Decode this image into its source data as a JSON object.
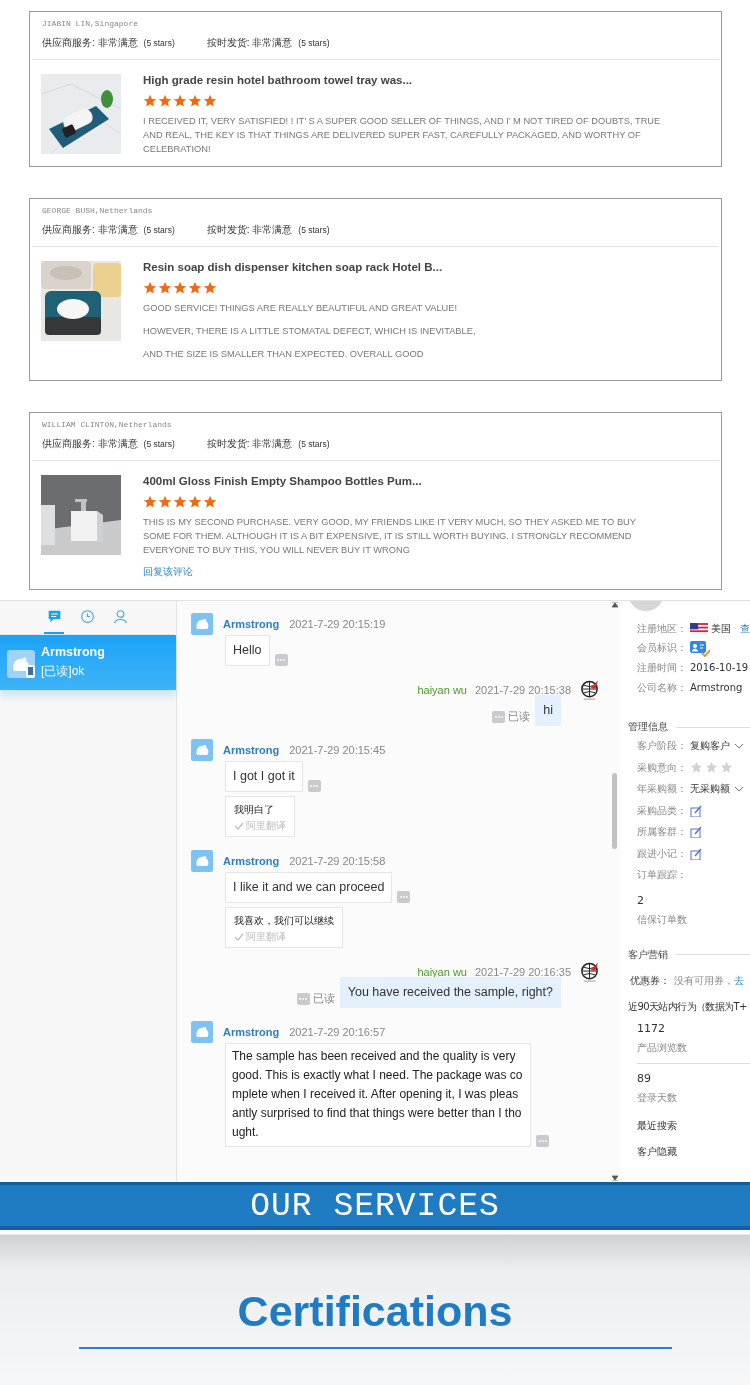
{
  "reviews": [
    {
      "reviewer": "JIABIN LIN,Singapore",
      "ratings": [
        {
          "label": "供应商服务:",
          "value": "非常满意",
          "note": "(5 stars)"
        },
        {
          "label": "按时发货:",
          "value": "非常满意",
          "note": "(5 stars)"
        }
      ],
      "product_title": "High grade resin hotel bathroom towel tray was...",
      "stars": 5,
      "paragraphs": [
        "I RECEIVED IT, VERY SATISFIED! ! IT’ S A SUPER GOOD SELLER OF THINGS, AND I’ M NOT TIRED OF DOUBTS, TRUE AND REAL, THE KEY IS THAT THINGS ARE DELIVERED SUPER FAST, CAREFULLY PACKAGED, AND WORTHY OF CELEBRATION!"
      ]
    },
    {
      "reviewer": "GEORGE BUSH,Netherlands",
      "ratings": [
        {
          "label": "供应商服务:",
          "value": "非常满意",
          "note": "(5 stars)"
        },
        {
          "label": "按时发货:",
          "value": "非常满意",
          "note": "(5 stars)"
        }
      ],
      "product_title": "Resin soap dish dispenser kitchen soap rack Hotel B...",
      "stars": 5,
      "paragraphs": [
        "GOOD SERVICE! THINGS ARE REALLY BEAUTIFUL AND GREAT VALUE!",
        "HOWEVER, THERE IS A LITTLE STOMATAL DEFECT, WHICH IS INEVITABLE,",
        "AND THE SIZE IS SMALLER THAN EXPECTED. OVERALL GOOD"
      ]
    },
    {
      "reviewer": "WILLIAM CLINTON,Netherlands",
      "ratings": [
        {
          "label": "供应商服务:",
          "value": "非常满意",
          "note": "(5 stars)"
        },
        {
          "label": "按时发货:",
          "value": "非常满意",
          "note": "(5 stars)"
        }
      ],
      "product_title": "400ml Gloss Finish Empty Shampoo Bottles Pum...",
      "stars": 5,
      "paragraphs": [
        "THIS IS MY SECOND PURCHASE. VERY GOOD, MY FRIENDS LIKE IT VERY MUCH, SO THEY ASKED ME TO BUY SOME FOR THEM. ALTHOUGH IT IS A BIT EXPENSIVE, IT IS STILL WORTH BUYING. I STRONGLY RECOMMEND EVERYONE TO BUY THIS, YOU WILL NEVER BUY IT WRONG"
      ],
      "reply_link": "回复该评论"
    }
  ],
  "chat": {
    "tabs": [
      {
        "kind": "messages",
        "selected": true
      },
      {
        "kind": "recent",
        "selected": false
      },
      {
        "kind": "contacts",
        "selected": false
      }
    ],
    "contacts": [
      {
        "name": "Armstrong",
        "preview": "[已读]ok",
        "selected": true
      }
    ],
    "messages": [
      {
        "kind": "incoming",
        "sender": "Armstrong",
        "time": "2021-7-29 20:15:19",
        "text": "Hello"
      },
      {
        "kind": "outgoing",
        "sender": "haiyan wu",
        "time": "2021-7-29 20:15:38",
        "text": "hi",
        "status": "已读"
      },
      {
        "kind": "incoming",
        "sender": "Armstrong",
        "time": "2021-7-29 20:15:45",
        "text": "I got I got it",
        "translation": {
          "text": "我明白了",
          "source": "阿里翻译"
        }
      },
      {
        "kind": "incoming",
        "sender": "Armstrong",
        "time": "2021-7-29 20:15:58",
        "text": "I like it and we can proceed",
        "translation": {
          "text": "我喜欢，我们可以继续",
          "source": "阿里翻译"
        }
      },
      {
        "kind": "outgoing",
        "sender": "haiyan wu",
        "time": "2021-7-29 20:16:35",
        "text": "You have received the sample, right?",
        "status": "已读"
      },
      {
        "kind": "incoming",
        "sender": "Armstrong",
        "time": "2021-7-29 20:16:57",
        "text": "The sample has been received and the quality is very good. This is exactly what I need. The package was complete when I received it. After opening it, I was pleasantly surprised to find that things were better than I thought."
      }
    ],
    "customer_panel": {
      "profile": [
        {
          "kind": "flag",
          "label": "注册地区：",
          "value": "美国",
          "link": "查"
        },
        {
          "kind": "badge",
          "label": "会员标识："
        },
        {
          "kind": "text",
          "label": "注册时间：",
          "value": "2016-10-19"
        },
        {
          "kind": "text",
          "label": "公司名称：",
          "value": "Armstrong"
        }
      ],
      "management": {
        "title": "管理信息",
        "fields": [
          {
            "kind": "dropdown",
            "label": "客户阶段：",
            "value": "复购客户"
          },
          {
            "kind": "stars",
            "label": "采购意向：",
            "stars": 0
          },
          {
            "kind": "dropdown",
            "label": "年采购额：",
            "value": "无采购额"
          },
          {
            "kind": "edit",
            "label": "采购品类："
          },
          {
            "kind": "edit",
            "label": "所属客群："
          },
          {
            "kind": "edit",
            "label": "跟进小记："
          },
          {
            "kind": "text",
            "label": "订单跟踪："
          }
        ],
        "stats": [
          {
            "value": "2",
            "label": "信保订单数"
          }
        ]
      },
      "marketing": {
        "title": "客户营销",
        "coupon_label": "优惠券：",
        "coupon_value": "没有可用券，",
        "coupon_link": "去"
      },
      "activity": {
        "title": "近90天站内行为（数据为T+",
        "stats": [
          {
            "value": "1172",
            "label": "产品浏览数"
          },
          {
            "value": "89",
            "label": "登录天数"
          }
        ],
        "links": [
          "最近搜索",
          "客户隐藏"
        ]
      }
    }
  },
  "banner": {
    "title": "OUR SERVICES"
  },
  "certifications": {
    "title": "Certifications"
  }
}
